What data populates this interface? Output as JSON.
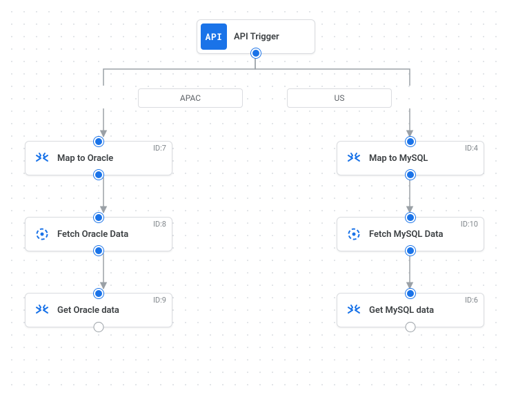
{
  "trigger": {
    "badge": "API",
    "label": "API Trigger"
  },
  "branches": {
    "left": "APAC",
    "right": "US"
  },
  "nodes": {
    "n7": {
      "label": "Map to Oracle",
      "id": "ID:7"
    },
    "n8": {
      "label": "Fetch Oracle Data",
      "id": "ID:8"
    },
    "n9": {
      "label": "Get Oracle data",
      "id": "ID:9"
    },
    "n4": {
      "label": "Map to MySQL",
      "id": "ID:4"
    },
    "n10": {
      "label": "Fetch MySQL Data",
      "id": "ID:10"
    },
    "n6": {
      "label": "Get MySQL data",
      "id": "ID:6"
    }
  }
}
